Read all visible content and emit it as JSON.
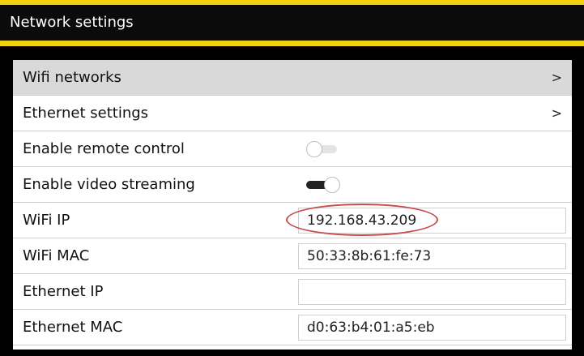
{
  "header": {
    "title": "Network settings"
  },
  "menu": {
    "wifi_networks": {
      "label": "Wifi networks",
      "chevron": ">"
    },
    "ethernet_settings": {
      "label": "Ethernet settings",
      "chevron": ">"
    }
  },
  "toggles": {
    "remote_control": {
      "label": "Enable remote control",
      "enabled": false
    },
    "video_streaming": {
      "label": "Enable video streaming",
      "enabled": true
    }
  },
  "info": {
    "wifi_ip": {
      "label": "WiFi IP",
      "value": "192.168.43.209"
    },
    "wifi_mac": {
      "label": "WiFi MAC",
      "value": "50:33:8b:61:fe:73"
    },
    "ethernet_ip": {
      "label": "Ethernet IP",
      "value": ""
    },
    "ethernet_mac": {
      "label": "Ethernet MAC",
      "value": "d0:63:b4:01:a5:eb"
    }
  },
  "colors": {
    "accent": "#f1d214",
    "annotation": "#c94a4a"
  }
}
